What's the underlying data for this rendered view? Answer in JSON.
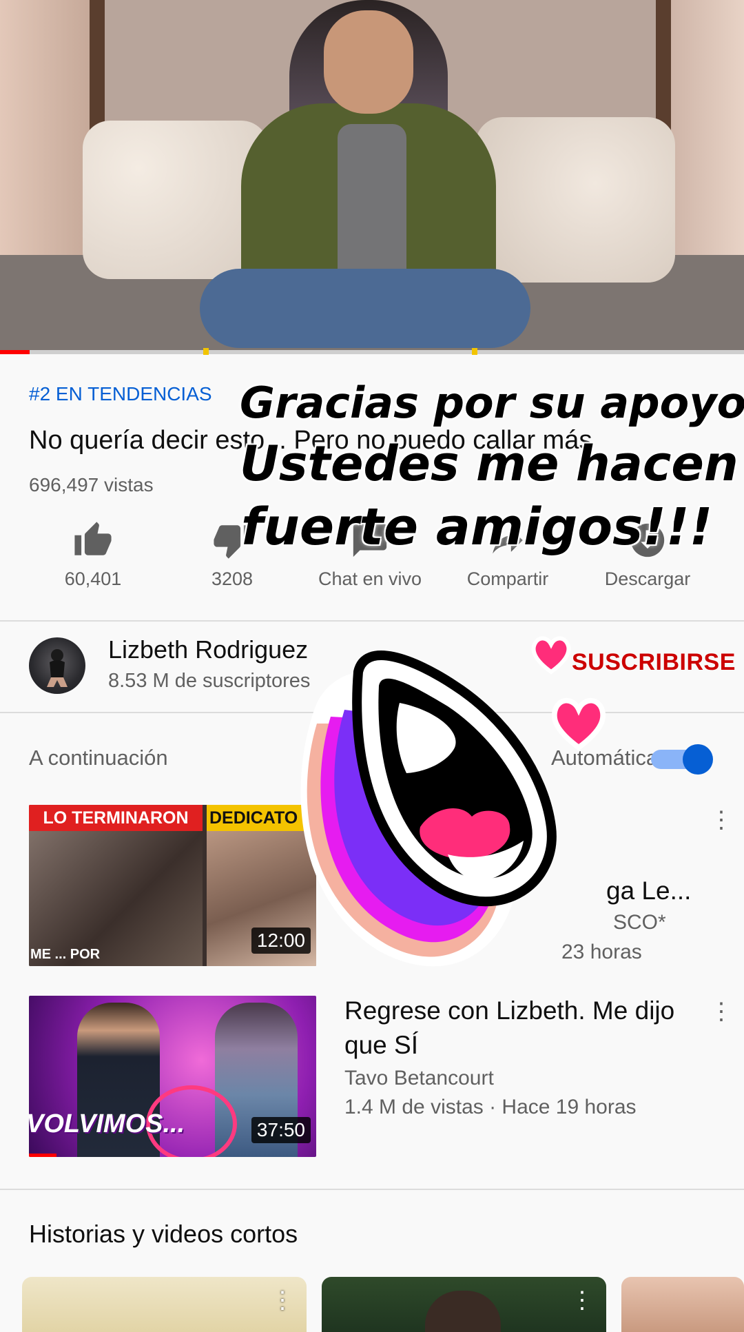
{
  "video": {
    "progress": 0.04,
    "trending": "#2 EN TENDENCIAS",
    "title": "No quería decir esto... Pero no puedo callar más",
    "views": "696,497 vistas"
  },
  "actions": [
    {
      "icon": "thumbs-up-icon",
      "label": "60,401"
    },
    {
      "icon": "thumbs-down-icon",
      "label": "3208"
    },
    {
      "icon": "live-chat-icon",
      "label": "Chat en vivo"
    },
    {
      "icon": "share-icon",
      "label": "Compartir"
    },
    {
      "icon": "download-icon",
      "label": "Descargar"
    }
  ],
  "channel": {
    "name": "Lizbeth Rodriguez",
    "subscribers": "8.53 M de suscriptores",
    "subscribe_label": "SUSCRIBIRSE"
  },
  "up_next": {
    "heading": "A continuación",
    "autoplay_label": "Automática",
    "autoplay_on": true
  },
  "videos": [
    {
      "thumb_left_caption": "LO TERMINARON",
      "thumb_right_caption": "DEDICATO",
      "thumb_small_text": "ME ... POR",
      "duration": "12:00",
      "title_visible": "ga Le...",
      "channel_visible": "SCO*",
      "meta_visible": "23 horas"
    },
    {
      "thumb_caption": "VOLVIMOS...",
      "duration": "37:50",
      "title": "Regrese con Lizbeth. Me dijo que SÍ",
      "channel": "Tavo Betancourt",
      "meta": "1.4 M de vistas · Hace 19 horas"
    }
  ],
  "shorts": {
    "heading": "Historias y videos cortos"
  },
  "overlay": {
    "line1": "Gracias por su apoyo!",
    "line2": "Ustedes me hacen",
    "line3": "fuerte amigos!!!"
  },
  "colors": {
    "brand_red": "#ff0000",
    "subscribe_red": "#cc0000",
    "link_blue": "#065fd4",
    "heart_pink": "#ff2d7a",
    "sticker_purple": "#7b2ff7",
    "sticker_magenta": "#e61cf0",
    "sticker_peach": "#f5b1a0"
  }
}
